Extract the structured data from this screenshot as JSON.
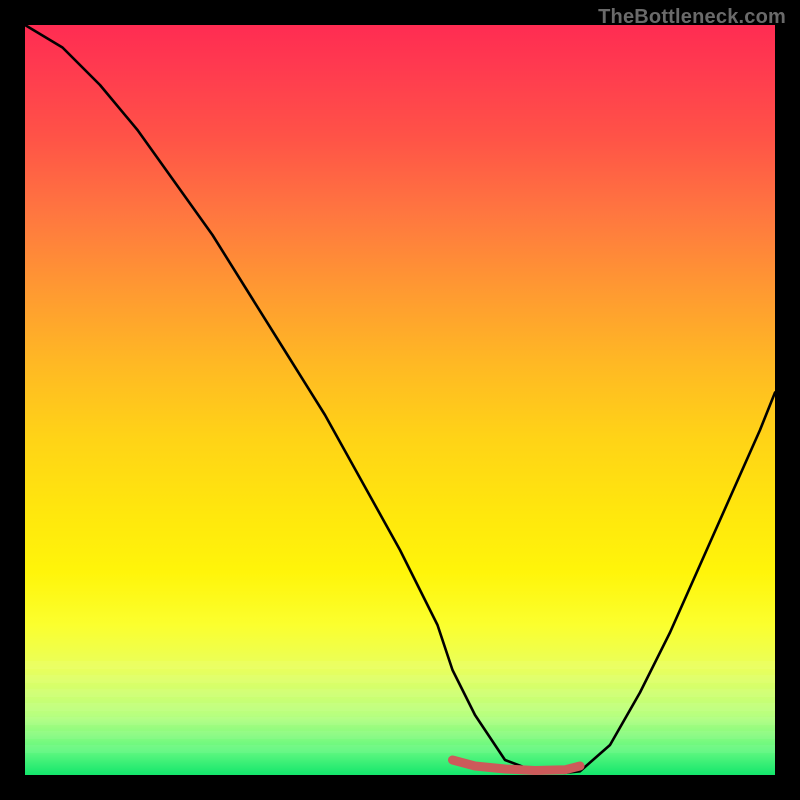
{
  "watermark": "TheBottleneck.com",
  "chart_data": {
    "type": "line",
    "title": "",
    "xlabel": "",
    "ylabel": "",
    "x_range_normalized": [
      0,
      100
    ],
    "ylim": [
      0,
      100
    ],
    "series": [
      {
        "name": "curve",
        "x": [
          0,
          5,
          10,
          15,
          20,
          25,
          30,
          35,
          40,
          45,
          50,
          55,
          57,
          60,
          64,
          68,
          72,
          74,
          78,
          82,
          86,
          90,
          94,
          98,
          100
        ],
        "values": [
          100,
          97,
          92,
          86,
          79,
          72,
          64,
          56,
          48,
          39,
          30,
          20,
          14,
          8,
          2,
          0.5,
          0.3,
          0.5,
          4,
          11,
          19,
          28,
          37,
          46,
          51
        ]
      },
      {
        "name": "ideal-segment",
        "color": "#cc5a5a",
        "x": [
          57,
          60,
          64,
          68,
          72,
          74
        ],
        "values": [
          2,
          1.2,
          0.8,
          0.6,
          0.7,
          1.2
        ]
      }
    ],
    "gradient_stops": [
      {
        "pos": 0,
        "color": "#ff2c52"
      },
      {
        "pos": 25,
        "color": "#ff7640"
      },
      {
        "pos": 55,
        "color": "#ffd317"
      },
      {
        "pos": 80,
        "color": "#fbff2e"
      },
      {
        "pos": 100,
        "color": "#13e66c"
      }
    ]
  }
}
